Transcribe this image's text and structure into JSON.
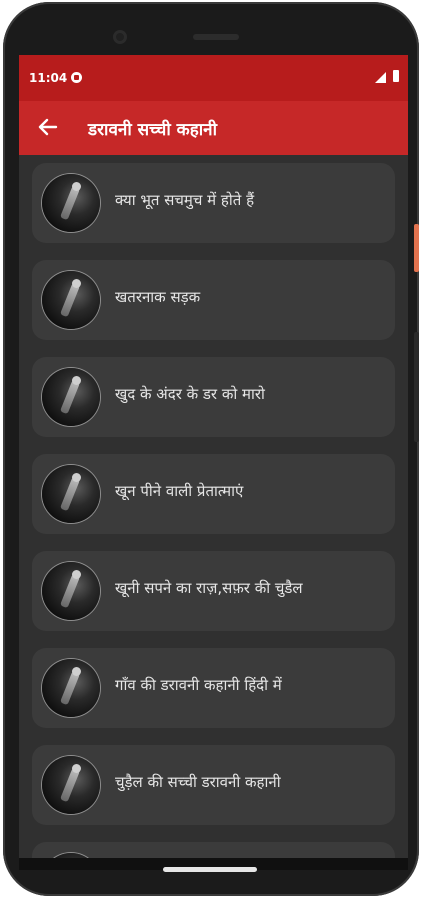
{
  "status_bar": {
    "time": "11:04"
  },
  "app_bar": {
    "title": "डरावनी सच्ची कहानी"
  },
  "icons": {
    "back": "arrow-left-icon",
    "app_status": "app-status-icon",
    "signal": "signal-icon",
    "battery": "battery-icon",
    "thumbnail": "ghost-thumbnail"
  },
  "colors": {
    "status_bar": "#b71c1c",
    "app_bar": "#c62828",
    "background": "#303030",
    "card": "#3b3b3b",
    "text": "#e6e6e6"
  },
  "stories": [
    {
      "title": "क्या भूत सचमुच में होते हैं"
    },
    {
      "title": "खतरनाक सड़क"
    },
    {
      "title": "खुद के अंदर के डर को मारो"
    },
    {
      "title": "खून पीने वाली प्रेतात्माएं"
    },
    {
      "title": "खूनी सपने का राज़,सफ़र की चुडैल"
    },
    {
      "title": "गाँव की डरावनी कहानी हिंदी में"
    },
    {
      "title": "चुड़ैल की सच्ची डरावनी कहानी"
    },
    {
      "title": ""
    }
  ]
}
